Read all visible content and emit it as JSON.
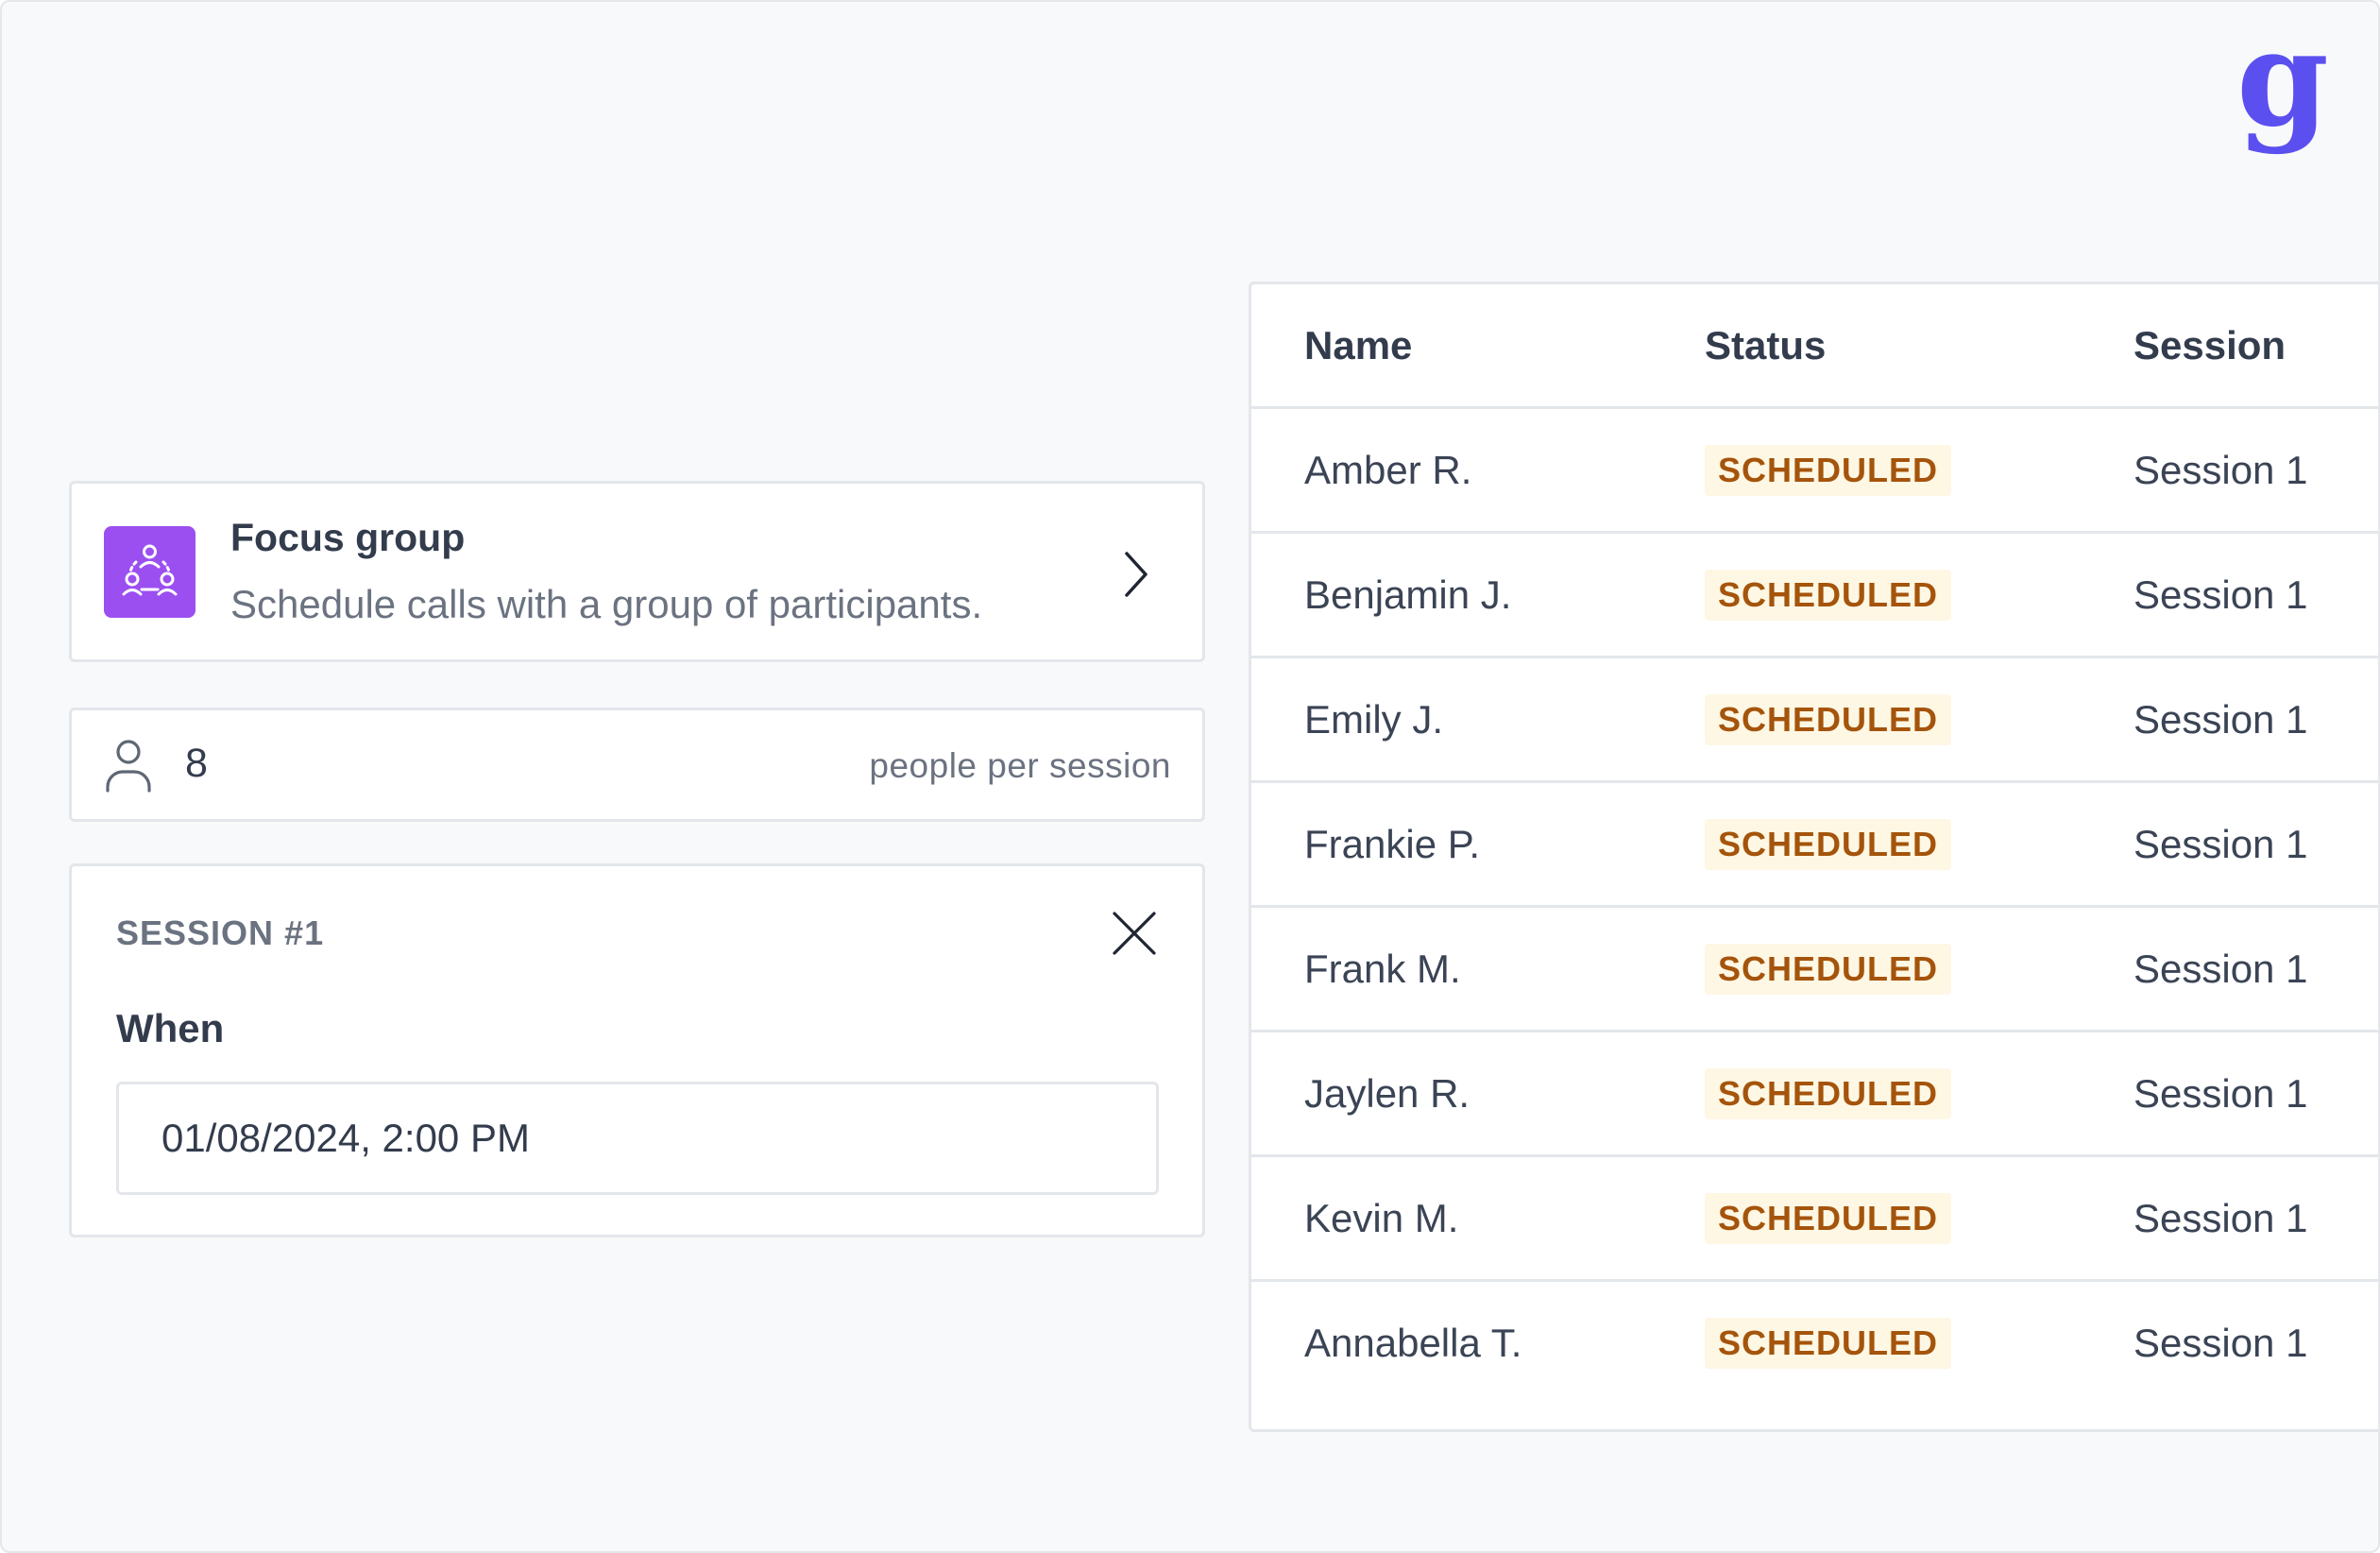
{
  "brand": {
    "logo_letter": "g",
    "color": "#5b4ff0"
  },
  "focus_group": {
    "title": "Focus group",
    "description": "Schedule calls with a group of participants.",
    "icon": "group-icon",
    "icon_bg": "#9b4ff0"
  },
  "people": {
    "count": "8",
    "label": "people per session",
    "icon": "person-icon"
  },
  "session": {
    "heading": "SESSION #1",
    "when_label": "When",
    "when_value": "01/08/2024, 2:00 PM"
  },
  "table": {
    "columns": [
      "Name",
      "Status",
      "Session"
    ],
    "rows": [
      {
        "name": "Amber R.",
        "status": "SCHEDULED",
        "session": "Session 1"
      },
      {
        "name": "Benjamin J.",
        "status": "SCHEDULED",
        "session": "Session 1"
      },
      {
        "name": "Emily J.",
        "status": "SCHEDULED",
        "session": "Session 1"
      },
      {
        "name": "Frankie P.",
        "status": "SCHEDULED",
        "session": "Session 1"
      },
      {
        "name": "Frank M.",
        "status": "SCHEDULED",
        "session": "Session 1"
      },
      {
        "name": "Jaylen R.",
        "status": "SCHEDULED",
        "session": "Session 1"
      },
      {
        "name": "Kevin M.",
        "status": "SCHEDULED",
        "session": "Session 1"
      },
      {
        "name": "Annabella T.",
        "status": "SCHEDULED",
        "session": "Session 1"
      }
    ],
    "status_color": "#a5540b",
    "status_bg": "#fdf7e4"
  }
}
